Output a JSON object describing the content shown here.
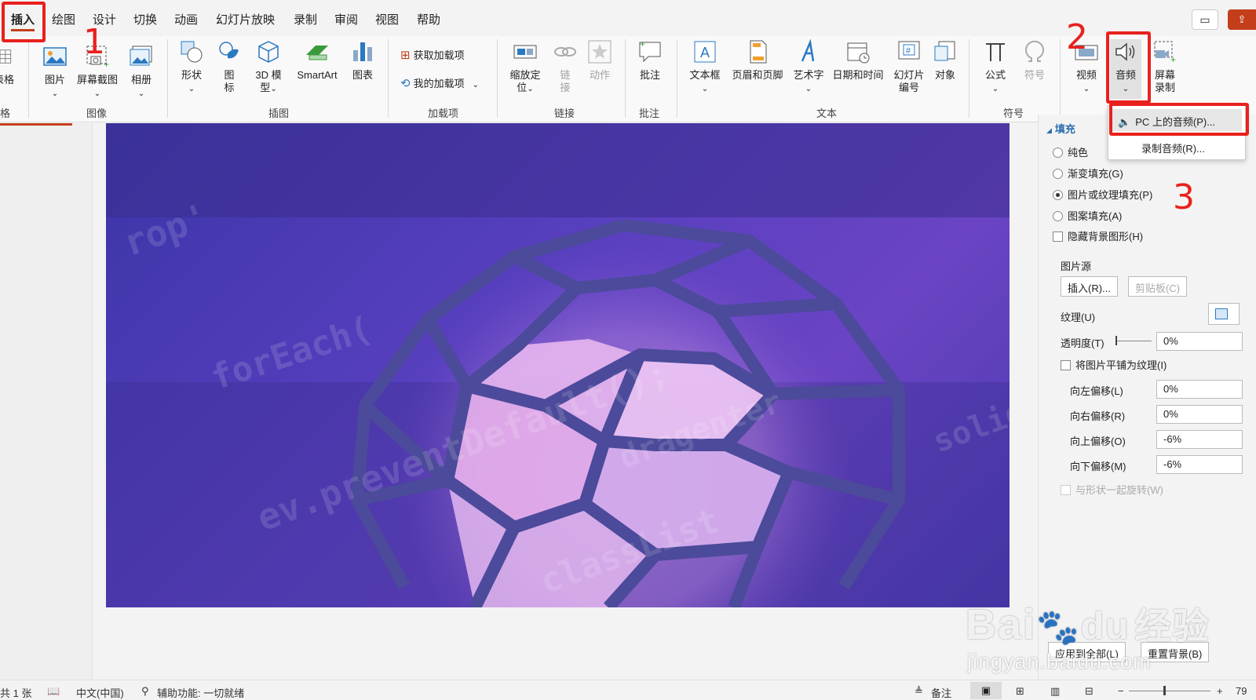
{
  "menu_tabs": [
    "插入",
    "绘图",
    "设计",
    "切换",
    "动画",
    "幻灯片放映",
    "录制",
    "审阅",
    "视图",
    "帮助"
  ],
  "ribbon": {
    "table_partial": "表格",
    "images": {
      "pictures": "图片",
      "screenshot": "屏幕截图",
      "album": "相册",
      "group": "图像"
    },
    "illustrations": {
      "shapes": "形状",
      "icons_1": "图",
      "icons_2": "标",
      "model_1": "3D 模",
      "model_2": "型",
      "smartart": "SmartArt",
      "chart": "图表",
      "group": "插图"
    },
    "addins": {
      "get": "获取加载项",
      "my": "我的加载项",
      "group": "加载项"
    },
    "links": {
      "zoom_1": "缩放定",
      "zoom_2": "位",
      "link_1": "链",
      "link_2": "接",
      "action": "动作",
      "group": "链接"
    },
    "comments": {
      "comment": "批注",
      "group": "批注"
    },
    "text": {
      "textbox": "文本框",
      "header_footer": "页眉和页脚",
      "wordart": "艺术字",
      "datetime": "日期和时间",
      "slide_num_1": "幻灯片",
      "slide_num_2": "编号",
      "object": "对象",
      "group": "文本"
    },
    "symbols": {
      "equation": "公式",
      "symbol": "符号",
      "group": "符号"
    },
    "media": {
      "video": "视频",
      "audio": "音频",
      "screen_rec_1": "屏幕",
      "screen_rec_2": "录制"
    }
  },
  "audio_menu": {
    "pc_audio": "PC 上的音频(P)...",
    "record_audio": "录制音频(R)..."
  },
  "annotations": {
    "n1": "1",
    "n2": "2",
    "n3": "3"
  },
  "format_panel": {
    "section": "填充",
    "solid": "纯色",
    "gradient": "渐变填充(G)",
    "picture": "图片或纹理填充(P)",
    "pattern": "图案填充(A)",
    "hide_bg": "隐藏背景图形(H)",
    "picture_source": "图片源",
    "insert": "插入(R)...",
    "clipboard": "剪贴板(C)",
    "texture": "纹理(U)",
    "transparency": "透明度(T)",
    "transparency_val": "0%",
    "tile": "将图片平铺为纹理(I)",
    "offset_left": "向左偏移(L)",
    "offset_left_val": "0%",
    "offset_right": "向右偏移(R)",
    "offset_right_val": "0%",
    "offset_top": "向上偏移(O)",
    "offset_top_val": "-6%",
    "offset_bottom": "向下偏移(M)",
    "offset_bottom_val": "-6%",
    "rotate": "与形状一起旋转(W)",
    "apply_all": "应用到全部(L)",
    "reset": "重置背景(B)"
  },
  "statusbar": {
    "slides": "共 1 张",
    "lang": "中文(中国)",
    "accessibility": "辅助功能: 一切就绪",
    "notes": "备注",
    "zoom": "79"
  },
  "watermark": {
    "brand": "Bai",
    "brand2": "经验",
    "url": "jingyan.baidu.com"
  },
  "slide_code_text": [
    "forEach(",
    "ev.preventDefault();",
    "dragenter",
    "classList",
    "rop'",
    "solid"
  ]
}
